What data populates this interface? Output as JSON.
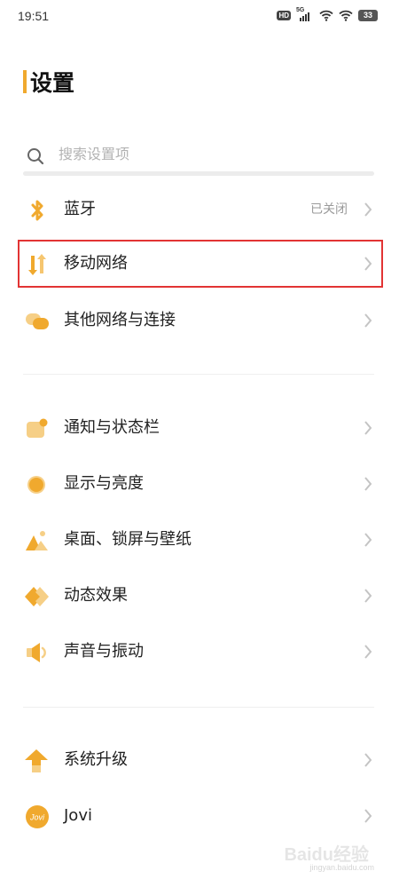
{
  "status_bar": {
    "time": "19:51",
    "hd_badge": "HD",
    "network_tag": "5G",
    "battery": "33"
  },
  "header": {
    "title": "设置"
  },
  "search": {
    "placeholder": "搜索设置项"
  },
  "accent_color": "#f0a92e",
  "highlight_color": "#e23434",
  "settings": {
    "bluetooth": {
      "label": "蓝牙",
      "value": "已关闭",
      "icon": "bluetooth-icon"
    },
    "mobile_network": {
      "label": "移动网络",
      "icon": "mobile-data-icon",
      "highlighted": true
    },
    "other_networks": {
      "label": "其他网络与连接",
      "icon": "link-icon"
    },
    "notifications": {
      "label": "通知与状态栏",
      "icon": "notification-icon"
    },
    "display": {
      "label": "显示与亮度",
      "icon": "brightness-icon"
    },
    "wallpaper": {
      "label": "桌面、锁屏与壁纸",
      "icon": "wallpaper-icon"
    },
    "animations": {
      "label": "动态效果",
      "icon": "animation-icon"
    },
    "sound": {
      "label": "声音与振动",
      "icon": "speaker-icon"
    },
    "system_update": {
      "label": "系统升级",
      "icon": "update-arrow-icon"
    },
    "jovi": {
      "label": "Jovi",
      "icon_text": "Jovi",
      "icon": "jovi-icon"
    }
  },
  "watermark": {
    "main": "Baidu经验",
    "sub": "jingyan.baidu.com"
  }
}
